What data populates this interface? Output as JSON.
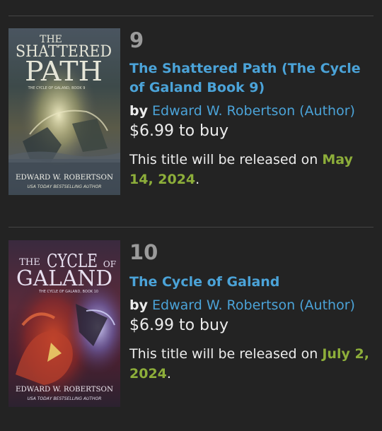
{
  "books": [
    {
      "rank": "9",
      "title": "The Shattered Path (The Cycle of Galand Book 9)",
      "by_label": "by",
      "author": "Edward W. Robertson (Author)",
      "price": "$6.99 to buy",
      "release_prefix": "This title will be released on",
      "release_date": "May 14, 2024",
      "release_suffix": ".",
      "cover": {
        "title_line1": "THE",
        "title_line2": "SHATTERED",
        "title_line3": "PATH",
        "series": "THE CYCLE OF GALAND, BOOK 9",
        "author": "EDWARD W. ROBERTSON",
        "tagline": "USA TODAY BESTSELLING AUTHOR"
      }
    },
    {
      "rank": "10",
      "title": "The Cycle of Galand",
      "by_label": "by",
      "author": "Edward W. Robertson (Author)",
      "price": "$6.99 to buy",
      "release_prefix": "This title will be released on",
      "release_date": "July 2, 2024",
      "release_suffix": ".",
      "cover": {
        "title_line1a": "THE",
        "title_line1b": "CYCLE",
        "title_line1c": "OF",
        "title_line2": "GALAND",
        "series": "THE CYCLE OF GALAND, BOOK 10",
        "author": "EDWARD W. ROBERTSON",
        "tagline": "USA TODAY BESTSELLING AUTHOR"
      }
    }
  ],
  "colors": {
    "background": "#232323",
    "link": "#4ba3d8",
    "date": "#8dae3a",
    "rank": "#9a9a9a"
  }
}
